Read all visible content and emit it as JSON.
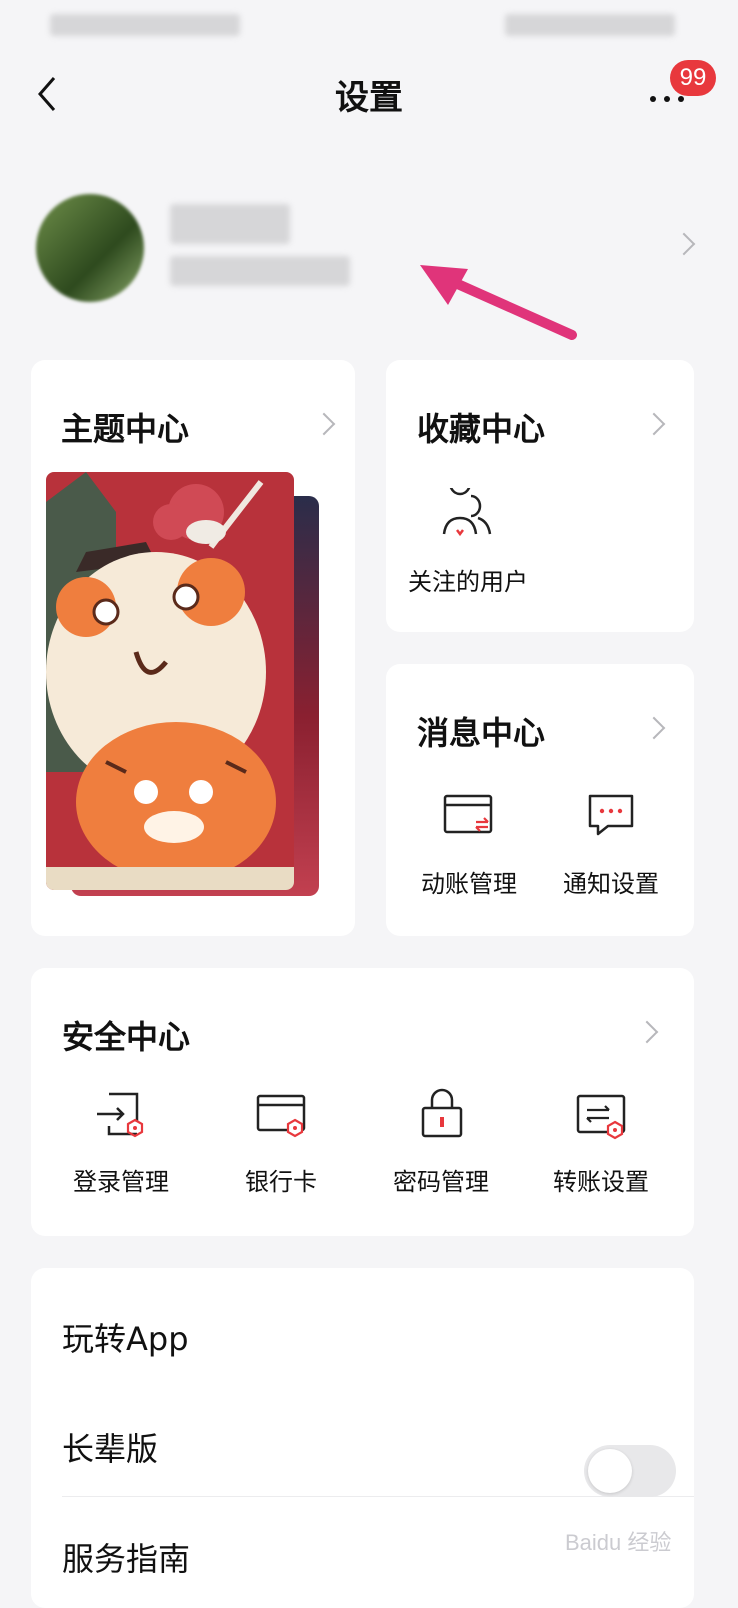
{
  "header": {
    "title": "设置",
    "badge": "99"
  },
  "profile": {
    "name": "",
    "account": ""
  },
  "theme_center": {
    "title": "主题中心"
  },
  "favorites_center": {
    "title": "收藏中心",
    "items": [
      {
        "label": "关注的用户",
        "icon": "users-icon"
      }
    ]
  },
  "message_center": {
    "title": "消息中心",
    "items": [
      {
        "label": "动账管理",
        "icon": "card-transfer-icon"
      },
      {
        "label": "通知设置",
        "icon": "chat-icon"
      }
    ]
  },
  "security_center": {
    "title": "安全中心",
    "items": [
      {
        "label": "登录管理",
        "icon": "login-icon"
      },
      {
        "label": "银行卡",
        "icon": "bank-card-icon"
      },
      {
        "label": "密码管理",
        "icon": "lock-icon"
      },
      {
        "label": "转账设置",
        "icon": "transfer-icon"
      }
    ]
  },
  "play_app": {
    "title": "玩转App",
    "rows": [
      {
        "label": "长辈版",
        "toggle": false
      },
      {
        "label": "服务指南"
      }
    ]
  },
  "colors": {
    "accent": "#e8383d",
    "annotation_arrow": "#e0347a",
    "background": "#f5f5f7"
  },
  "watermark": "Baidu 经验"
}
